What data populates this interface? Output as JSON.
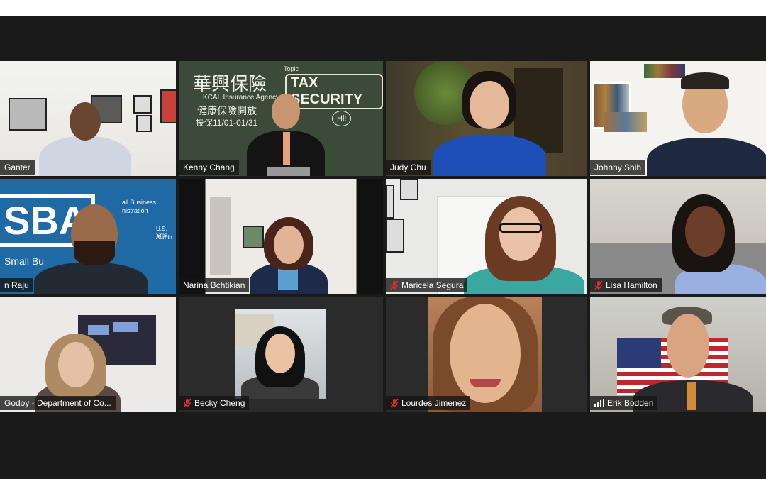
{
  "meeting": {
    "participants": [
      {
        "name": "Ganter",
        "muted": false
      },
      {
        "name": "Kenny Chang",
        "muted": false,
        "active_speaker": true
      },
      {
        "name": "Judy Chu",
        "muted": false
      },
      {
        "name": "Johnny Shih",
        "muted": false
      },
      {
        "name": "n Raju",
        "muted": false
      },
      {
        "name": "Narina Bchtikian",
        "muted": false
      },
      {
        "name": "Maricela Segura",
        "muted": true
      },
      {
        "name": "Lisa Hamilton",
        "muted": true
      },
      {
        "name": "Godoy - Department of Co...",
        "muted": false
      },
      {
        "name": "Becky Cheng",
        "muted": true
      },
      {
        "name": "Lourdes Jimenez",
        "muted": true
      },
      {
        "name": "Erik Bodden",
        "muted": false,
        "signal": true
      }
    ]
  },
  "backgrounds": {
    "chalkboard": {
      "title_cn": "華興保險",
      "agency": "KCAL Insurance Agency",
      "line_cn": "健康保險開放",
      "dates": "投保11/01-01/31",
      "topic_label": "Topic",
      "topic": "TAX SECURITY",
      "bubble": "Hi!"
    },
    "sba": {
      "logo": "SBA",
      "text1": "all Business",
      "text2": "nistration",
      "text3": "U.S. Sma",
      "text4": "Admin",
      "text5": "Small Bu"
    }
  },
  "colors": {
    "active_outline": "#d7e84a",
    "mute_red": "#e02e2e",
    "chalkboard": "#3c4a3a",
    "sba_blue": "#1f6aa5"
  }
}
